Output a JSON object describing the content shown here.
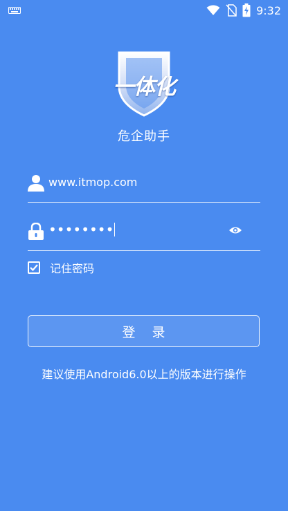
{
  "status_bar": {
    "time": "9:32",
    "icons": [
      "keyboard-icon",
      "wifi-icon",
      "no-sim-icon",
      "battery-charging-icon"
    ]
  },
  "app": {
    "logo_text": "一体化",
    "name": "危企助手"
  },
  "login": {
    "username_value": "www.itmop.com",
    "password_mask": "••••••••",
    "remember_label": "记住密码",
    "remember_checked": true,
    "login_label": "登录",
    "hint": "建议使用Android6.0以上的版本进行操作"
  },
  "colors": {
    "background": "#4a8bf0",
    "text": "#ffffff"
  }
}
